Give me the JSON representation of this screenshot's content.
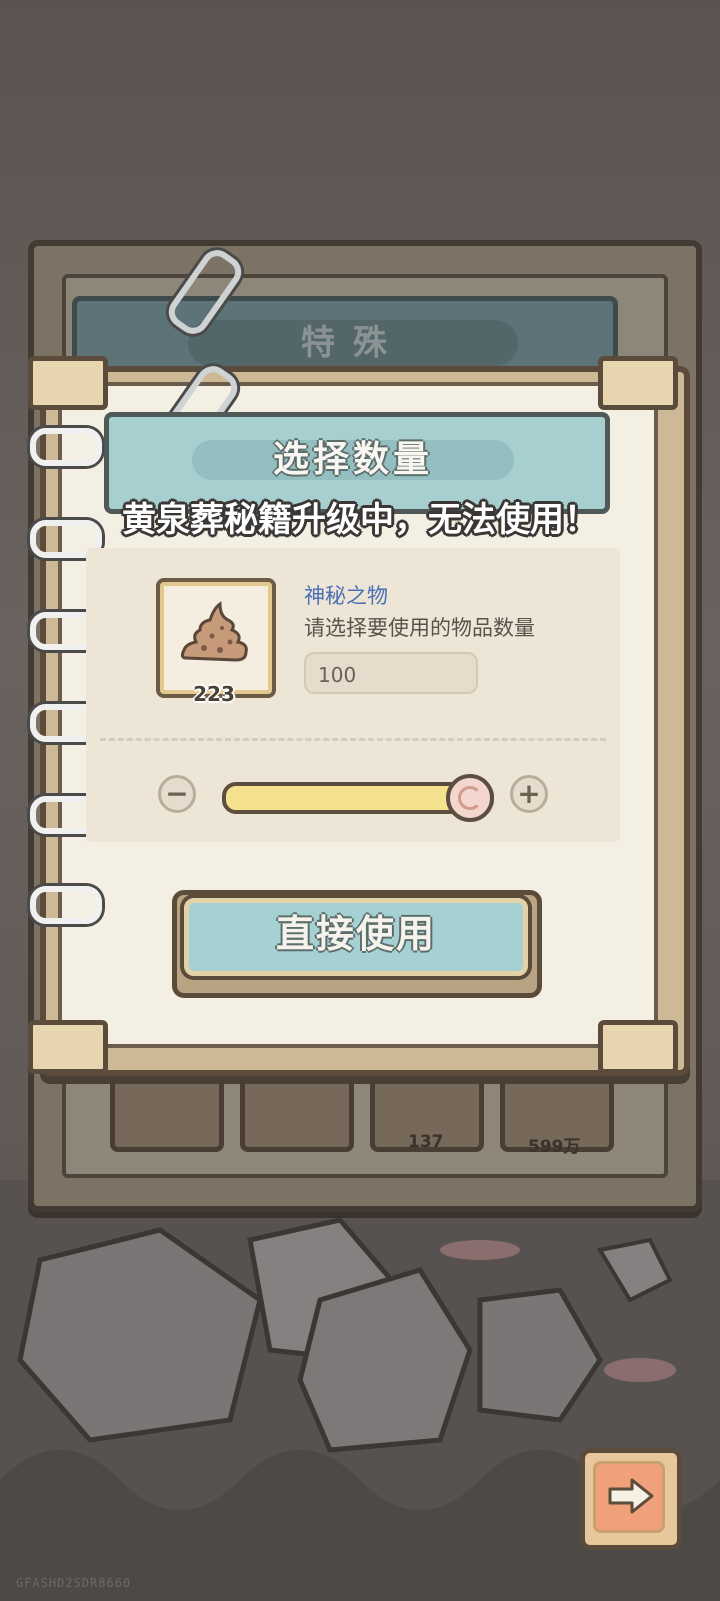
{
  "back_panel": {
    "title": "特殊",
    "slot_counts": [
      "137",
      "599万"
    ]
  },
  "dialog": {
    "title": "选择数量",
    "toast": "黄泉葬秘籍升级中，无法使用！",
    "item": {
      "icon": "mysterious-item-icon",
      "count": "223",
      "name": "神秘之物",
      "description": "请选择要使用的物品数量"
    },
    "quantity_value": "100",
    "slider_level": 1.0,
    "minus_symbol": "−",
    "plus_symbol": "+",
    "use_button": "直接使用"
  },
  "navigation": {
    "next_icon": "arrow-right-icon"
  },
  "watermark": "GFASHD2SDR8660",
  "colors": {
    "title_bar": "#a7cfd0",
    "item_name": "#4b6fb6",
    "slider_fill": "#f4e28f",
    "use_button": "#a6d1d2"
  }
}
